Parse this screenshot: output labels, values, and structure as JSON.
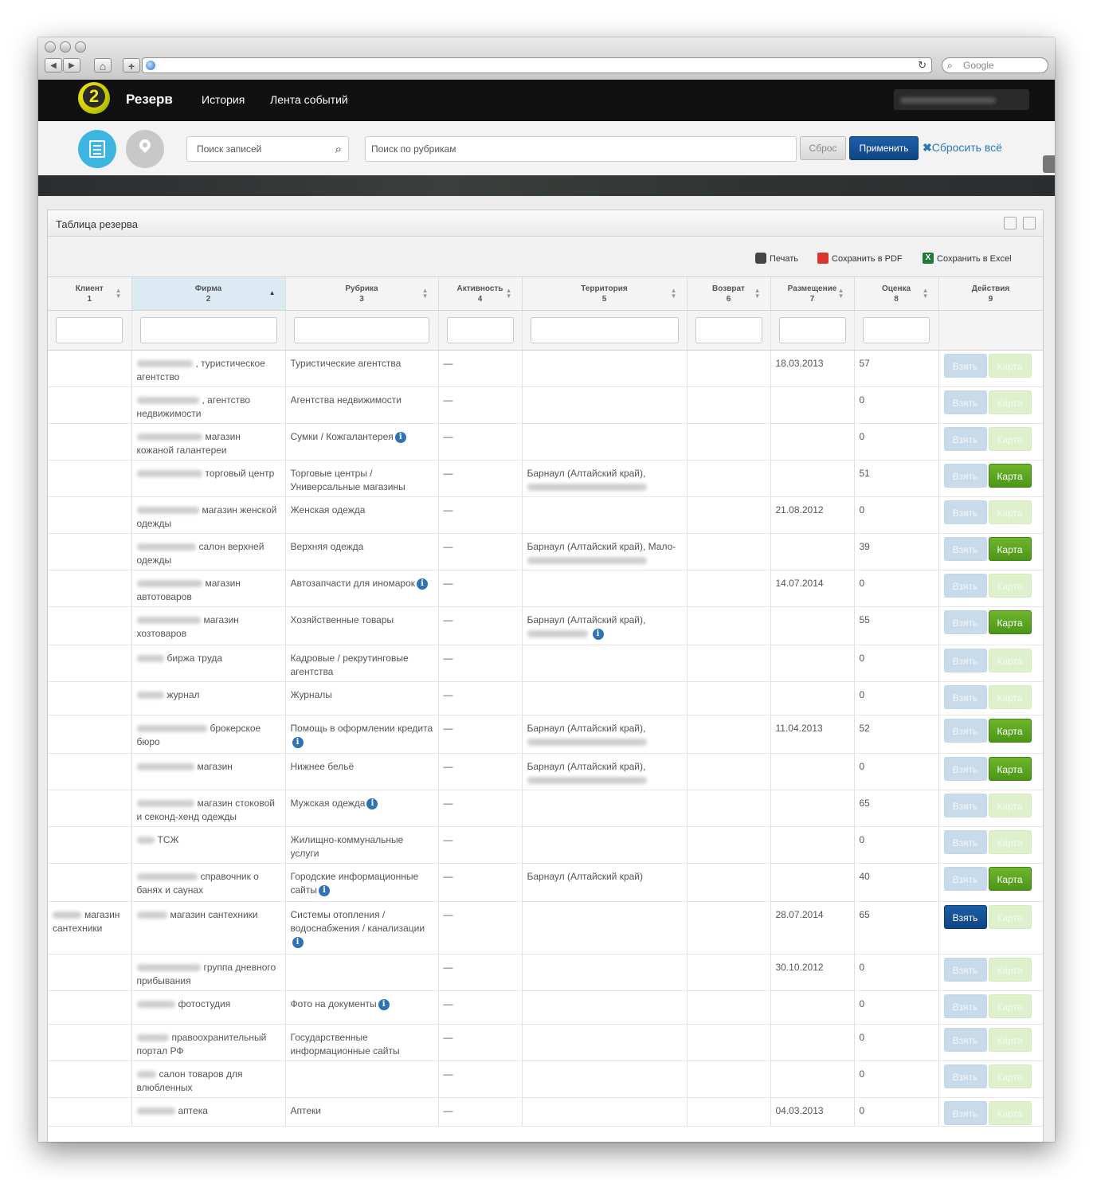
{
  "browser": {
    "back": "◀",
    "forward": "▶",
    "home": "⌂",
    "new_tab": "+",
    "reload": "↻",
    "search_placeholder": "Google"
  },
  "topnav": {
    "logo_char": "2",
    "brand": "Резерв",
    "links": [
      "История",
      "Лента событий"
    ]
  },
  "filters": {
    "search_placeholder": "Поиск записей",
    "rubric_placeholder": "Поиск по рубрикам",
    "reset_label": "Сброс",
    "apply_label": "Применить",
    "reset_all_label": "Сбросить всё"
  },
  "panel": {
    "title": "Таблица резерва",
    "tools": {
      "print": "Печать",
      "pdf": "Сохранить в PDF",
      "excel": "Сохранить в Excel",
      "excel_icon": "X"
    }
  },
  "table": {
    "columns": [
      {
        "name": "Клиент",
        "num": "1"
      },
      {
        "name": "Фирма",
        "num": "2"
      },
      {
        "name": "Рубрика",
        "num": "3"
      },
      {
        "name": "Активность",
        "num": "4"
      },
      {
        "name": "Территория",
        "num": "5"
      },
      {
        "name": "Возврат",
        "num": "6"
      },
      {
        "name": "Размещение",
        "num": "7"
      },
      {
        "name": "Оценка",
        "num": "8"
      },
      {
        "name": "Действия",
        "num": "9"
      }
    ],
    "sort_column": "Фирма",
    "action_take": "Взять",
    "action_map": "Карта",
    "rows": [
      {
        "client": "",
        "firm": ", туристическое агентство",
        "rubric": "Туристические агентства",
        "rubric_info": false,
        "activity": "—",
        "territory": "",
        "placement": "18.03.2013",
        "score": "57",
        "take_active": false,
        "map_active": false
      },
      {
        "client": "",
        "firm": ", агентство недвижимости",
        "rubric": "Агентства недвижимости",
        "rubric_info": false,
        "activity": "—",
        "territory": "",
        "placement": "",
        "score": "0",
        "take_active": false,
        "map_active": false
      },
      {
        "client": "",
        "firm": "магазин кожаной галантереи",
        "rubric": "Сумки / Кожгалантерея",
        "rubric_info": true,
        "activity": "—",
        "territory": "",
        "placement": "",
        "score": "0",
        "take_active": false,
        "map_active": false
      },
      {
        "client": "",
        "firm": "торговый центр",
        "rubric": "Торговые центры / Универсальные магазины",
        "rubric_info": false,
        "activity": "—",
        "territory": "Барнаул (Алтайский край),",
        "placement": "",
        "score": "51",
        "take_active": false,
        "map_active": true
      },
      {
        "client": "",
        "firm": "магазин женской одежды",
        "rubric": "Женская одежда",
        "rubric_info": false,
        "activity": "—",
        "territory": "",
        "placement": "21.08.2012",
        "score": "0",
        "take_active": false,
        "map_active": false
      },
      {
        "client": "",
        "firm": "салон верхней одежды",
        "rubric": "Верхняя одежда",
        "rubric_info": false,
        "activity": "—",
        "territory": "Барнаул (Алтайский край), Мало-",
        "placement": "",
        "score": "39",
        "take_active": false,
        "map_active": true
      },
      {
        "client": "",
        "firm": "магазин автотоваров",
        "rubric": "Автозапчасти для иномарок",
        "rubric_info": true,
        "activity": "—",
        "territory": "",
        "placement": "14.07.2014",
        "score": "0",
        "take_active": false,
        "map_active": false
      },
      {
        "client": "",
        "firm": "магазин хозтоваров",
        "rubric": "Хозяйственные товары",
        "rubric_info": false,
        "activity": "—",
        "territory": "Барнаул (Алтайский край),",
        "placement": "",
        "score": "55",
        "take_active": false,
        "map_active": true
      },
      {
        "client": "",
        "firm": "биржа труда",
        "rubric": "Кадровые / рекрутинговые агентства",
        "rubric_info": false,
        "activity": "—",
        "territory": "",
        "placement": "",
        "score": "0",
        "take_active": false,
        "map_active": false
      },
      {
        "client": "",
        "firm": "журнал",
        "rubric": "Журналы",
        "rubric_info": false,
        "activity": "—",
        "territory": "",
        "placement": "",
        "score": "0",
        "take_active": false,
        "map_active": false
      },
      {
        "client": "",
        "firm": "брокерское бюро",
        "rubric": "Помощь в оформлении кредита",
        "rubric_info": true,
        "activity": "—",
        "territory": "Барнаул (Алтайский край),",
        "placement": "11.04.2013",
        "score": "52",
        "take_active": false,
        "map_active": true
      },
      {
        "client": "",
        "firm": "магазин",
        "rubric": "Нижнее бельё",
        "rubric_info": false,
        "activity": "—",
        "territory": "Барнаул (Алтайский край),",
        "placement": "",
        "score": "0",
        "take_active": false,
        "map_active": true
      },
      {
        "client": "",
        "firm": "магазин стоковой и секонд-хенд одежды",
        "rubric": "Мужская одежда",
        "rubric_info": true,
        "activity": "—",
        "territory": "",
        "placement": "",
        "score": "65",
        "take_active": false,
        "map_active": false
      },
      {
        "client": "",
        "firm": "ТСЖ",
        "rubric": "Жилищно-коммунальные услуги",
        "rubric_info": false,
        "activity": "—",
        "territory": "",
        "placement": "",
        "score": "0",
        "take_active": false,
        "map_active": false
      },
      {
        "client": "",
        "firm": "справочник о банях и саунах",
        "rubric": "Городские информационные сайты",
        "rubric_info": true,
        "activity": "—",
        "territory": "Барнаул (Алтайский край)",
        "placement": "",
        "score": "40",
        "take_active": false,
        "map_active": true
      },
      {
        "client": "магазин сантехники",
        "firm": "магазин сантехники",
        "rubric": "Системы отопления / водоснабжения / канализации",
        "rubric_info": true,
        "activity": "—",
        "territory": "",
        "placement": "28.07.2014",
        "score": "65",
        "take_active": true,
        "map_active": false
      },
      {
        "client": "",
        "firm": "группа дневного прибывания",
        "rubric": "",
        "rubric_info": false,
        "activity": "—",
        "territory": "",
        "placement": "30.10.2012",
        "score": "0",
        "take_active": false,
        "map_active": false
      },
      {
        "client": "",
        "firm": "фотостудия",
        "rubric": "Фото на документы",
        "rubric_info": true,
        "activity": "—",
        "territory": "",
        "placement": "",
        "score": "0",
        "take_active": false,
        "map_active": false
      },
      {
        "client": "",
        "firm": "правоохранительный портал РФ",
        "rubric": "Государственные информационные сайты",
        "rubric_info": false,
        "activity": "—",
        "territory": "",
        "placement": "",
        "score": "0",
        "take_active": false,
        "map_active": false
      },
      {
        "client": "",
        "firm": "салон товаров для влюбленных",
        "rubric": "",
        "rubric_info": false,
        "activity": "—",
        "territory": "",
        "placement": "",
        "score": "0",
        "take_active": false,
        "map_active": false
      },
      {
        "client": "",
        "firm": "аптека",
        "rubric": "Аптеки",
        "rubric_info": false,
        "activity": "—",
        "territory": "",
        "placement": "04.03.2013",
        "score": "0",
        "take_active": false,
        "map_active": false
      }
    ]
  },
  "colors": {
    "accent": "#3cb5e0",
    "apply": "#0f4585",
    "map_active": "#4c9618",
    "topbar": "#111111"
  }
}
